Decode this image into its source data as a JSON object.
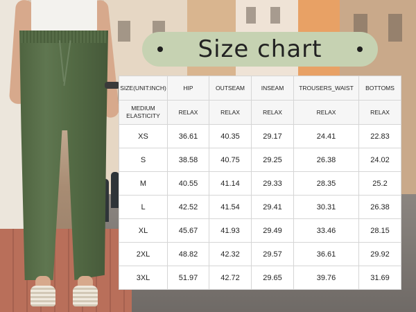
{
  "title": "Size chart",
  "table": {
    "headers": [
      "SIZE(UNIT:INCH)",
      "HIP",
      "OUTSEAM",
      "INSEAM",
      "TROUSERS_WAIST",
      "BOTTOMS"
    ],
    "elasticity_row": [
      "MEDIUM ELASTICITY",
      "RELAX",
      "RELAX",
      "RELAX",
      "RELAX",
      "RELAX"
    ],
    "rows": [
      [
        "XS",
        "36.61",
        "40.35",
        "29.17",
        "24.41",
        "22.83"
      ],
      [
        "S",
        "38.58",
        "40.75",
        "29.25",
        "26.38",
        "24.02"
      ],
      [
        "M",
        "40.55",
        "41.14",
        "29.33",
        "28.35",
        "25.2"
      ],
      [
        "L",
        "42.52",
        "41.54",
        "29.41",
        "30.31",
        "26.38"
      ],
      [
        "XL",
        "45.67",
        "41.93",
        "29.49",
        "33.46",
        "28.15"
      ],
      [
        "2XL",
        "48.82",
        "42.32",
        "29.57",
        "36.61",
        "29.92"
      ],
      [
        "3XL",
        "51.97",
        "42.72",
        "29.65",
        "39.76",
        "31.69"
      ]
    ]
  },
  "colors": {
    "pill_background": "#c6d2b2",
    "pants": "#5a7049",
    "table_header_bg": "#f6f6f6"
  }
}
